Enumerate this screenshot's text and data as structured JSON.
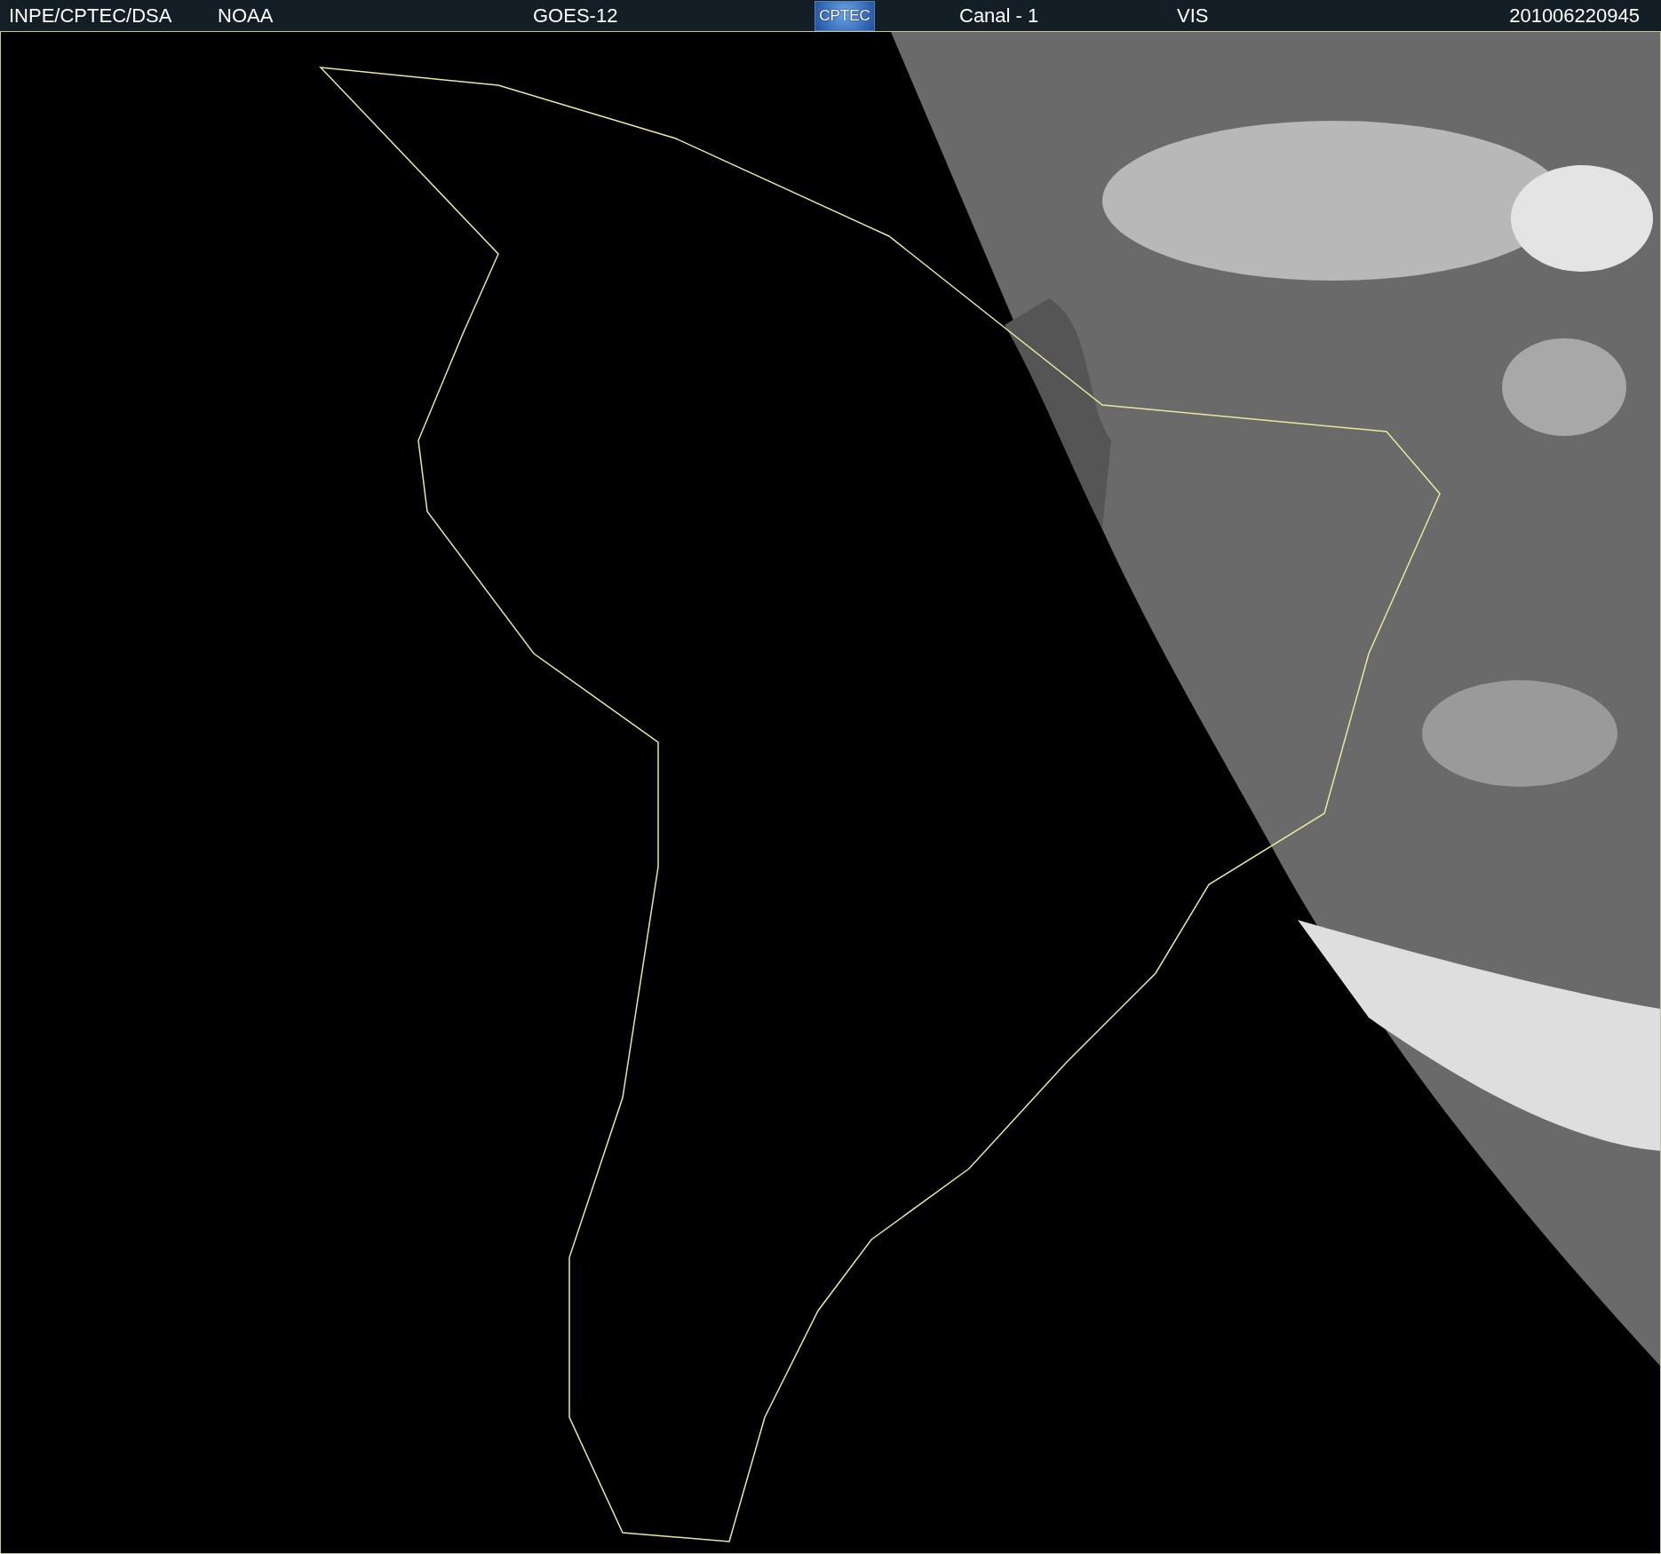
{
  "header": {
    "items": [
      {
        "kind": "text",
        "text": "INPE/CPTEC/DSA"
      },
      {
        "kind": "text",
        "text": "NOAA"
      },
      {
        "kind": "text",
        "text": "GOES-12"
      },
      {
        "kind": "logo",
        "text": "CPTEC"
      },
      {
        "kind": "text",
        "text": "Canal - 1"
      },
      {
        "kind": "text",
        "text": "VIS"
      },
      {
        "kind": "text",
        "text": "201006220945"
      }
    ]
  }
}
